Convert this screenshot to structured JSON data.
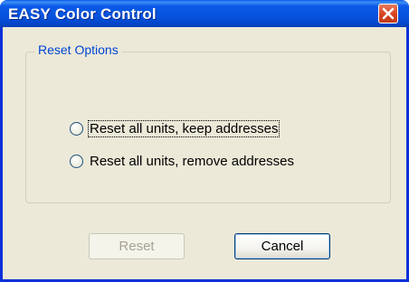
{
  "window": {
    "title": "EASY Color Control",
    "close_icon": "close-icon"
  },
  "reset_options": {
    "group_label": "Reset Options",
    "options": [
      {
        "label": "Reset all units, keep addresses",
        "selected": false,
        "focused": true
      },
      {
        "label": "Reset all units, remove addresses",
        "selected": false,
        "focused": false
      }
    ]
  },
  "buttons": {
    "reset_label": "Reset",
    "reset_enabled": false,
    "cancel_label": "Cancel"
  },
  "colors": {
    "titlebar": "#0653dd",
    "dialog_bg": "#ece9d8",
    "group_label": "#0046d5",
    "close_button": "#d6431e"
  }
}
